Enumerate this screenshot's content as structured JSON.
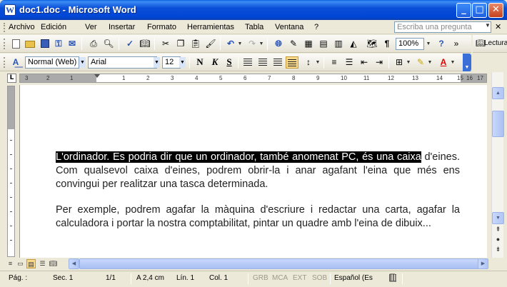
{
  "window": {
    "title": "doc1.doc - Microsoft Word",
    "app_icon": "W"
  },
  "window_controls": {
    "minimize": "_",
    "maximize": "□",
    "close": "✕"
  },
  "menu": {
    "items": [
      "Archivo",
      "Edición",
      "Ver",
      "Insertar",
      "Formato",
      "Herramientas",
      "Tabla",
      "Ventana",
      "?"
    ],
    "help_placeholder": "Escriba una pregunta",
    "close_doc": "✕"
  },
  "standard_toolbar": {
    "icons": [
      "new-icon",
      "open-icon",
      "save-icon",
      "permission-icon",
      "email-icon",
      "print-icon",
      "print-preview-icon",
      "spelling-icon",
      "research-icon",
      "cut-icon",
      "copy-icon",
      "paste-icon",
      "format-painter-icon",
      "undo-icon",
      "redo-icon",
      "hyperlink-icon",
      "tables-borders-icon",
      "insert-table-icon",
      "insert-excel-icon",
      "columns-icon",
      "drawing-icon",
      "document-map-icon",
      "show-formatting-icon",
      "help-icon"
    ],
    "zoom": "100%",
    "read_label": "Lectura"
  },
  "format_toolbar": {
    "style": "Normal (Web) +",
    "font": "Arial",
    "size": "12",
    "bold": "N",
    "italic": "K",
    "underline": "S"
  },
  "ruler": {
    "labels": [
      "3",
      "2",
      "1",
      "1",
      "2",
      "3",
      "4",
      "5",
      "6",
      "7",
      "8",
      "9",
      "10",
      "11",
      "12",
      "13",
      "14",
      "15",
      "16",
      "17"
    ]
  },
  "document": {
    "highlighted": "L'ordinador. Es podria dir que un ordinador, també anomenat PC, és una caixa",
    "para1_rest": "d'eines. Com qualsevol caixa d'eines, podrem obrir-la i anar agafant l'eina que més ens convingui per realitzar una tasca determinada.",
    "para2": "Per exemple, podrem agafar la màquina d'escriure i redactar una carta, agafar la calculadora i portar la nostra comptabilitat, pintar un quadre amb l'eina de dibuix..."
  },
  "status": {
    "page": "Pág.  :",
    "section": "Sec.  1",
    "page_of": "1/1",
    "at": "A  2,4 cm",
    "line": "Lín.  1",
    "col": "Col.  1",
    "rec": "GRB",
    "trk": "MCA",
    "ext": "EXT",
    "ovr": "SOB",
    "language": "Español (Es"
  },
  "colors": {
    "titlebar": "#0046d5",
    "chrome": "#ece9d8",
    "highlight_bg": "#000000",
    "highlight_fg": "#ffffff",
    "active_button": "#fbd98a"
  }
}
